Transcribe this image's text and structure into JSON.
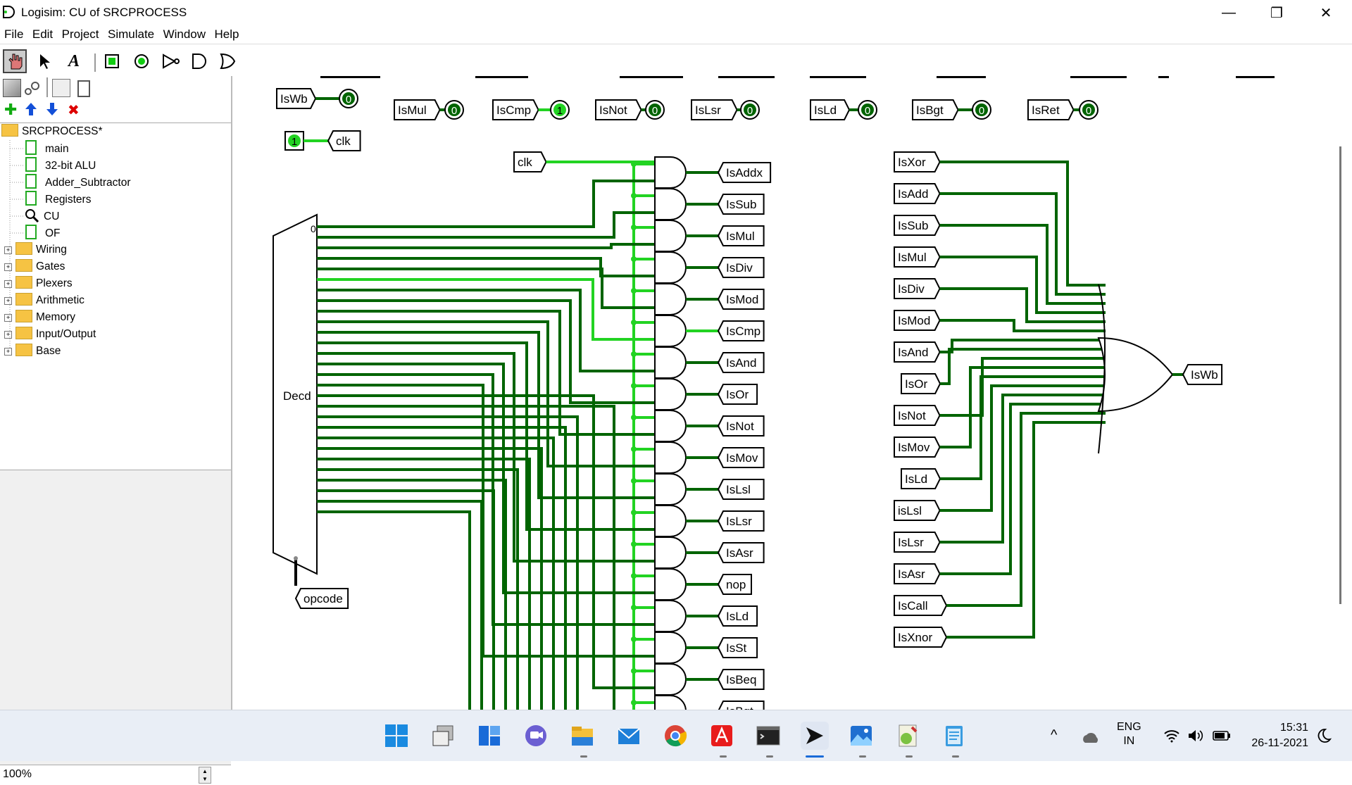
{
  "window": {
    "title": "Logisim: CU of SRCPROCESS",
    "minimize": "—",
    "maximize": "❐",
    "close": "✕"
  },
  "menu": [
    "File",
    "Edit",
    "Project",
    "Simulate",
    "Window",
    "Help"
  ],
  "toolbar": {
    "tools": [
      "hand-poke-icon",
      "select-arrow-icon",
      "text-tool-icon",
      "input-pin-icon",
      "output-pin-icon",
      "not-gate-icon",
      "and-gate-icon",
      "or-gate-icon"
    ]
  },
  "explorer": {
    "project": "SRCPROCESS*",
    "circuits": [
      "main",
      "32-bit ALU",
      "Adder_Subtractor",
      "Registers",
      "CU",
      "OF"
    ],
    "libraries": [
      "Wiring",
      "Gates",
      "Plexers",
      "Arithmetic",
      "Memory",
      "Input/Output",
      "Base"
    ]
  },
  "zoom": "100%",
  "circuit": {
    "top_row": [
      {
        "label": "IsWb",
        "value": "0"
      },
      {
        "label": "IsMul",
        "value": "0"
      },
      {
        "label": "IsCmp",
        "value": "1"
      },
      {
        "label": "IsNot",
        "value": "0"
      },
      {
        "label": "IsLsr",
        "value": "0"
      },
      {
        "label": "IsLd",
        "value": "0"
      },
      {
        "label": "IsBgt",
        "value": "0"
      },
      {
        "label": "IsRet",
        "value": "0"
      }
    ],
    "clock_value": "1",
    "clock_label": "clk",
    "clk_tunnel": "clk",
    "decoder_label": "Decd",
    "decoder_zero": "0",
    "opcode_label": "opcode",
    "and_outputs": [
      "IsAddx",
      "IsSub",
      "IsMul",
      "IsDiv",
      "IsMod",
      "IsCmp",
      "IsAnd",
      "IsOr",
      "IsNot",
      "IsMov",
      "IsLsl",
      "IsLsr",
      "IsAsr",
      "nop",
      "IsLd",
      "IsSt",
      "IsBeq",
      "IsBgt"
    ],
    "or_inputs": [
      "IsXor",
      "IsAdd",
      "IsSub",
      "IsMul",
      "IsDiv",
      "IsMod",
      "IsAnd",
      "IsOr",
      "IsNot",
      "IsMov",
      "IsLd",
      "isLsl",
      "IsLsr",
      "IsAsr",
      "IsCall",
      "IsXnor"
    ],
    "or_output": "IsWb"
  },
  "taskbar": {
    "apps": [
      "windows-start-icon",
      "task-view-icon",
      "widgets-icon",
      "teams-chat-icon",
      "file-explorer-icon",
      "mail-icon",
      "chrome-icon",
      "acrobat-icon",
      "terminal-icon",
      "logisim-icon",
      "photos-icon",
      "notepad-plus-icon",
      "notepad-icon"
    ],
    "language": "ENG",
    "region": "IN",
    "time": "15:31",
    "date": "26-11-2021"
  },
  "colors": {
    "wire_on": "#22d322",
    "wire_off": "#006400",
    "background": "#ffffff"
  }
}
